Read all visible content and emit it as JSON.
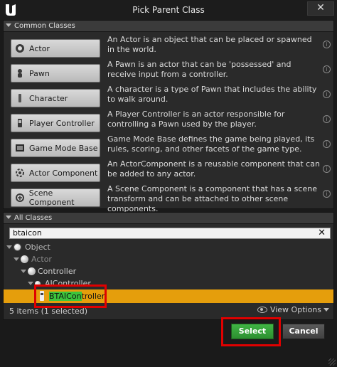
{
  "window": {
    "title": "Pick Parent Class",
    "close_label": "✕"
  },
  "common_classes": {
    "header": "Common Classes",
    "items": [
      {
        "label": "Actor",
        "icon": "actor-icon",
        "description": "An Actor is an object that can be placed or spawned in the world."
      },
      {
        "label": "Pawn",
        "icon": "pawn-icon",
        "description": "A Pawn is an actor that can be 'possessed' and receive input from a controller."
      },
      {
        "label": "Character",
        "icon": "character-icon",
        "description": "A character is a type of Pawn that includes the ability to walk around."
      },
      {
        "label": "Player Controller",
        "icon": "player-controller-icon",
        "description": "A Player Controller is an actor responsible for controlling a Pawn used by the player."
      },
      {
        "label": "Game Mode Base",
        "icon": "game-mode-icon",
        "description": "Game Mode Base defines the game being played, its rules, scoring, and other facets of the game type."
      },
      {
        "label": "Actor Component",
        "icon": "actor-component-icon",
        "description": "An ActorComponent is a reusable component that can be added to any actor."
      },
      {
        "label": "Scene Component",
        "icon": "scene-component-icon",
        "description": "A Scene Component is a component that has a scene transform and can be attached to other scene components."
      }
    ]
  },
  "all_classes": {
    "header": "All Classes",
    "search_value": "btaicon",
    "tree": [
      {
        "label": "Object",
        "depth": 0,
        "dim": false
      },
      {
        "label": "Actor",
        "depth": 1,
        "dim": true
      },
      {
        "label": "Controller",
        "depth": 2,
        "dim": false
      },
      {
        "label": "AIController",
        "depth": 3,
        "dim": false
      },
      {
        "label_match": "BTAICon",
        "label_rest": "troller",
        "depth": 4,
        "selected": true
      }
    ],
    "status": "5 items (1 selected)",
    "view_options": "View Options"
  },
  "buttons": {
    "select": "Select",
    "cancel": "Cancel"
  },
  "colors": {
    "selected_row": "#e59e0c",
    "search_highlight": "#3cc53c",
    "select_button": "#3aa83e",
    "annotation": "#e00000"
  }
}
